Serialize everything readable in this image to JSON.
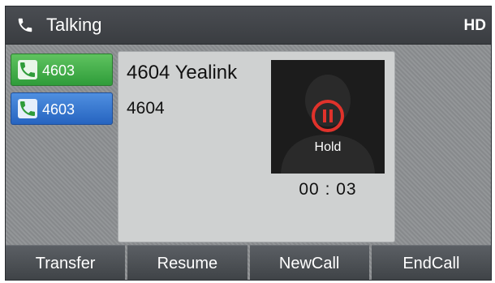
{
  "title_bar": {
    "icon": "phone-handset-icon",
    "title": "Talking",
    "hd": "HD"
  },
  "lines": [
    {
      "label": "4603",
      "icon": "phone-handset-icon",
      "color": "#3aa845"
    },
    {
      "label": "4603",
      "icon": "phone-handset-icon",
      "color": "#2f6fce"
    }
  ],
  "call": {
    "name": "4604 Yealink",
    "number": "4604",
    "status": "Hold",
    "status_icon": "pause-icon",
    "status_color": "#e0322b",
    "duration": "00 : 03",
    "avatar_icon": "contact-silhouette-icon"
  },
  "softkeys": [
    {
      "label": "Transfer"
    },
    {
      "label": "Resume"
    },
    {
      "label": "NewCall"
    },
    {
      "label": "EndCall"
    }
  ]
}
